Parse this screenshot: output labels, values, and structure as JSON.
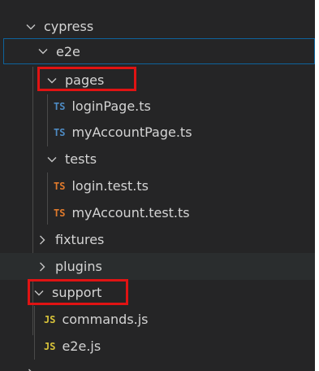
{
  "colors": {
    "panel_bg": "#252526",
    "text": "#d4d4d4",
    "ts_icon": "#4e8bc4",
    "ts_test_icon": "#e07a2c",
    "js_icon": "#d8c33a",
    "focus_border": "#0e639c",
    "highlight_box": "#e01313",
    "hover_bg": "#2a2d2e"
  },
  "tree": {
    "cypress": {
      "label": "cypress",
      "icon": "chevron-down-icon"
    },
    "e2e": {
      "label": "e2e",
      "icon": "chevron-down-icon",
      "focused": true
    },
    "pages": {
      "label": "pages",
      "icon": "chevron-down-icon",
      "highlighted": true
    },
    "login_page": {
      "label": "loginPage.ts",
      "badge": "TS"
    },
    "my_account_page": {
      "label": "myAccountPage.ts",
      "badge": "TS"
    },
    "tests": {
      "label": "tests",
      "icon": "chevron-down-icon"
    },
    "login_test": {
      "label": "login.test.ts",
      "badge": "TS"
    },
    "my_account_test": {
      "label": "myAccount.test.ts",
      "badge": "TS"
    },
    "fixtures": {
      "label": "fixtures",
      "icon": "chevron-right-icon"
    },
    "plugins": {
      "label": "plugins",
      "icon": "chevron-right-icon",
      "hovered": true
    },
    "support": {
      "label": "support",
      "icon": "chevron-down-icon",
      "highlighted": true
    },
    "commands": {
      "label": "commands.js",
      "badge": "JS"
    },
    "e2e_js": {
      "label": "e2e.js",
      "badge": "JS"
    }
  }
}
